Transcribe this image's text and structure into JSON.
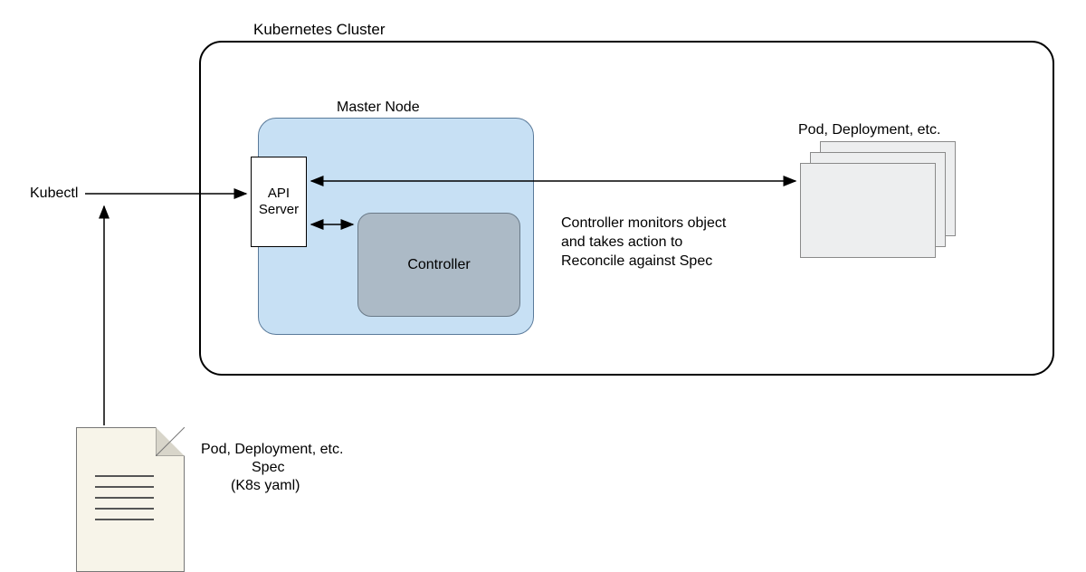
{
  "labels": {
    "cluster_title": "Kubernetes Cluster",
    "master_node": "Master Node",
    "api_server": "API Server",
    "controller": "Controller",
    "kubectl": "Kubectl",
    "pods_deployment": "Pod, Deployment, etc.",
    "controller_description": "Controller monitors object and takes action to Reconcile against Spec",
    "spec_line1": "Pod, Deployment, etc.",
    "spec_line2": "Spec",
    "spec_line3": "(K8s yaml)"
  },
  "diagram": {
    "type": "architecture",
    "nodes": [
      {
        "id": "kubectl",
        "label": "Kubectl"
      },
      {
        "id": "cluster",
        "label": "Kubernetes Cluster"
      },
      {
        "id": "master",
        "label": "Master Node",
        "parent": "cluster"
      },
      {
        "id": "api-server",
        "label": "API Server",
        "parent": "master"
      },
      {
        "id": "controller",
        "label": "Controller",
        "parent": "master"
      },
      {
        "id": "pods",
        "label": "Pod, Deployment, etc.",
        "parent": "cluster"
      },
      {
        "id": "spec-doc",
        "label": "Pod, Deployment, etc. Spec (K8s yaml)"
      }
    ],
    "edges": [
      {
        "from": "kubectl",
        "to": "api-server",
        "type": "arrow"
      },
      {
        "from": "spec-doc",
        "to": "kubectl",
        "type": "arrow"
      },
      {
        "from": "api-server",
        "to": "pods",
        "type": "double-arrow"
      },
      {
        "from": "api-server",
        "to": "controller",
        "type": "double-arrow"
      }
    ]
  }
}
